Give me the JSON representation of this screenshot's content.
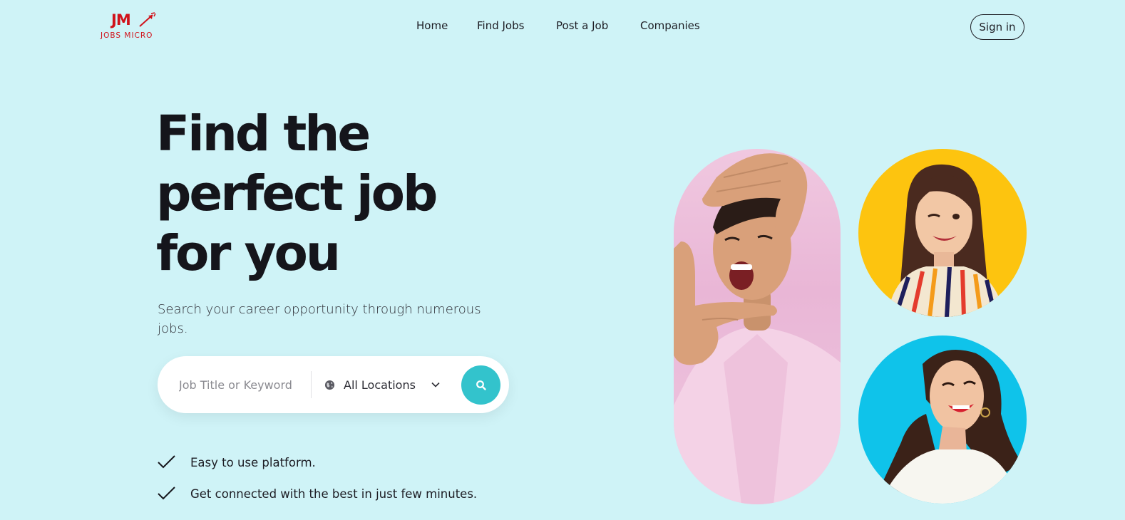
{
  "brand": {
    "mark": "JM",
    "name": "JOBS MICRO",
    "color": "#d0121a"
  },
  "nav": {
    "items": [
      {
        "label": "Home"
      },
      {
        "label": "Find Jobs"
      },
      {
        "label": "Post a Job"
      },
      {
        "label": "Companies"
      }
    ],
    "signin_label": "Sign in"
  },
  "hero": {
    "title_lines": [
      "Find the",
      "perfect job",
      "for you"
    ],
    "subtitle": "Search your career opportunity through numerous jobs."
  },
  "search": {
    "keyword_placeholder": "Job Title or Keyword",
    "keyword_value": "",
    "location_selected": "All Locations",
    "location_icon": "globe-icon",
    "submit_icon": "search-icon",
    "button_color": "#33c3cc"
  },
  "features": [
    {
      "icon": "check-icon",
      "text": "Easy to use platform."
    },
    {
      "icon": "check-icon",
      "text": "Get connected with the best in just few minutes."
    }
  ],
  "images": {
    "main": {
      "icon": "man-photo",
      "bg": "#efc7e0"
    },
    "top": {
      "icon": "woman-winking-photo",
      "bg": "#fdc40f"
    },
    "bottom": {
      "icon": "woman-smiling-photo",
      "bg": "#0fc3ea"
    }
  },
  "colors": {
    "background": "#cff3f7",
    "text": "#15151b",
    "accent": "#33c3cc"
  }
}
